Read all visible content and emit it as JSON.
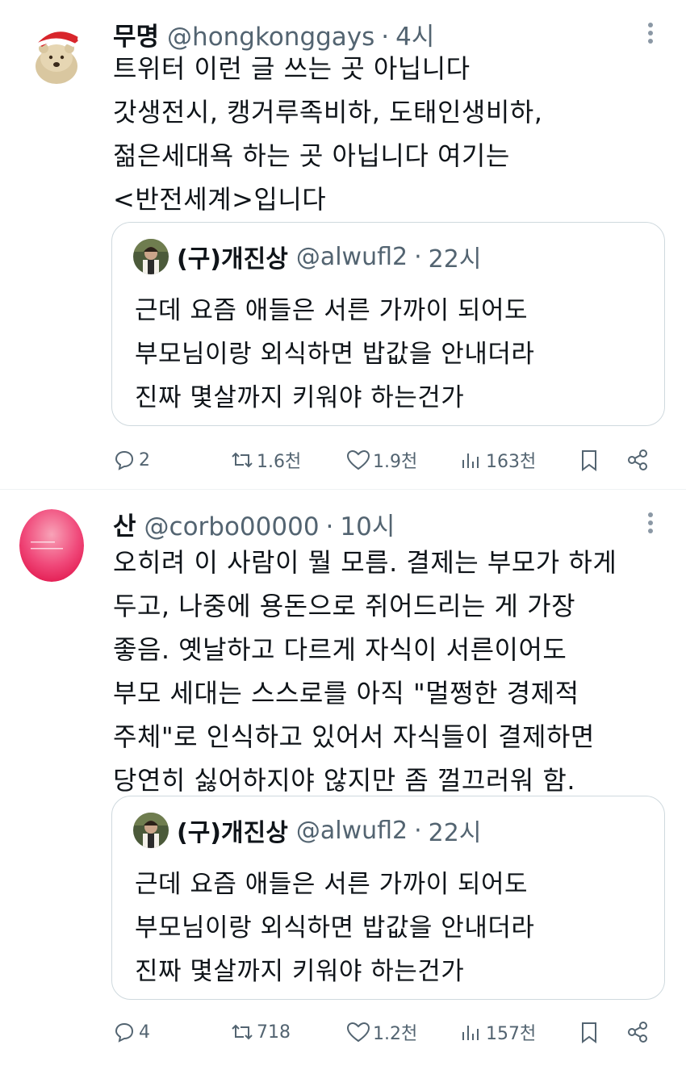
{
  "tweets": [
    {
      "name": "무명",
      "handle": "@hongkonggays",
      "dot": "·",
      "time": "4시",
      "avatar_icon": "polar-bear-santa-hat-avatar",
      "body": [
        "트위터 이런 글 쓰는 곳 아닙니다",
        "갓생전시, 캥거루족비하, 도태인생비하,",
        "젊은세대욕 하는 곳 아닙니다 여기는",
        "<반전세계>입니다"
      ],
      "quote": {
        "name": "(구)개진상",
        "handle": "@alwufl2",
        "dot": "·",
        "time": "22시",
        "body": [
          "근데 요즘 애들은 서른 가까이 되어도",
          "부모님이랑 외식하면 밥값을 안내더라",
          "진짜 몇살까지 키워야 하는건가"
        ]
      },
      "actions": {
        "replies": "2",
        "retweets": "1.6천",
        "likes": "1.9천",
        "views": "163천"
      }
    },
    {
      "name": "산",
      "handle": "@corbo00000",
      "dot": "·",
      "time": "10시",
      "avatar_icon": "pink-gradient-circle-avatar",
      "body": [
        "오히려 이 사람이 뭘 모름. 결제는 부모가 하게",
        "두고, 나중에 용돈으로 쥐어드리는 게 가장",
        "좋음. 옛날하고 다르게 자식이 서른이어도",
        "부모 세대는 스스로를 아직 \"멀쩡한 경제적",
        "주체\"로 인식하고 있어서 자식들이 결제하면",
        "당연히 싫어하지야 않지만 좀 껄끄러워 함."
      ],
      "quote": {
        "name": "(구)개진상",
        "handle": "@alwufl2",
        "dot": "·",
        "time": "22시",
        "body": [
          "근데 요즘 애들은 서른 가까이 되어도",
          "부모님이랑 외식하면 밥값을 안내더라",
          "진짜 몇살까지 키워야 하는건가"
        ]
      },
      "actions": {
        "replies": "4",
        "retweets": "718",
        "likes": "1.2천",
        "views": "157천"
      }
    }
  ],
  "colors": {
    "text": "#0f1419",
    "secondary": "#536471",
    "border": "#cfd9de"
  }
}
